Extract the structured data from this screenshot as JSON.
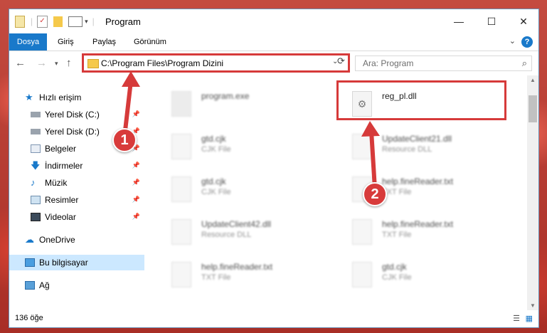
{
  "window": {
    "title": "Program",
    "controls": {
      "minimize": "—",
      "maximize": "☐",
      "close": "✕"
    }
  },
  "ribbon": {
    "tabs": [
      "Dosya",
      "Giriş",
      "Paylaş",
      "Görünüm"
    ],
    "help": "?",
    "accent": "#1979ca"
  },
  "address": {
    "path": "C:\\Program Files\\Program Dizini",
    "search_placeholder": "Ara: Program"
  },
  "nav_pane": {
    "quick_access": "Hızlı erişim",
    "items": [
      {
        "label": "Yerel Disk (C:)",
        "icon": "drive-icon",
        "pinned": true
      },
      {
        "label": "Yerel Disk (D:)",
        "icon": "drive-icon",
        "pinned": true
      },
      {
        "label": "Belgeler",
        "icon": "documents-icon",
        "pinned": true
      },
      {
        "label": "İndirmeler",
        "icon": "download-icon",
        "pinned": true
      },
      {
        "label": "Müzik",
        "icon": "music-icon",
        "pinned": true
      },
      {
        "label": "Resimler",
        "icon": "pictures-icon",
        "pinned": true
      },
      {
        "label": "Videolar",
        "icon": "video-icon",
        "pinned": true
      }
    ],
    "onedrive": "OneDrive",
    "this_pc": "Bu bilgisayar",
    "network": "Ağ"
  },
  "files": {
    "left": [
      {
        "name": "program.exe",
        "type": ""
      },
      {
        "name": "gtd.cjk",
        "type": "CJK File"
      },
      {
        "name": "gtd.cjk",
        "type": "CJK File"
      },
      {
        "name": "UpdateClient42.dll",
        "type": "Resource DLL"
      },
      {
        "name": "help.fineReader.txt",
        "type": "TXT File"
      }
    ],
    "right": [
      {
        "name": "reg_pl.dll",
        "type": ""
      },
      {
        "name": "UpdateClient21.dll",
        "type": "Resource DLL"
      },
      {
        "name": "help.fineReader.txt",
        "type": "TXT File"
      },
      {
        "name": "help.fineReader.txt",
        "type": "TXT File"
      },
      {
        "name": "gtd.cjk",
        "type": "CJK File"
      }
    ]
  },
  "status": {
    "item_count": "136 öğe"
  },
  "annotations": {
    "step1": "1",
    "step2": "2",
    "color": "#d63a3a"
  }
}
